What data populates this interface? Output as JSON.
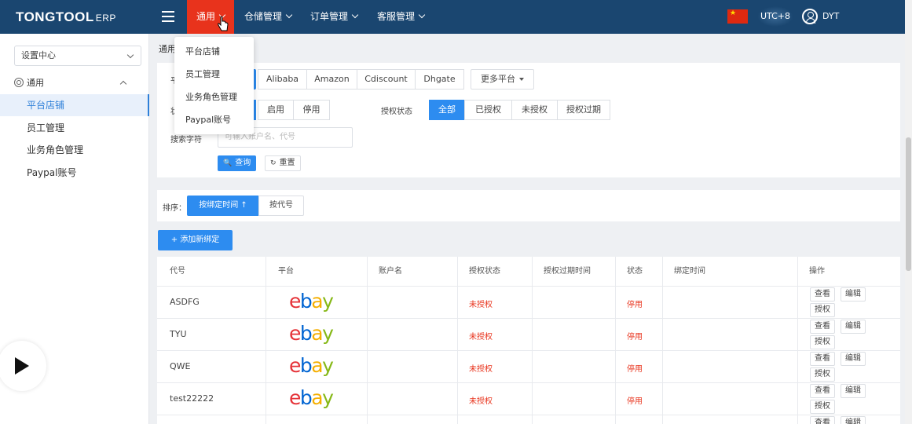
{
  "header": {
    "brand": "TONGTOOL",
    "brand_suffix": "ERP",
    "nav": [
      "通用",
      "仓储管理",
      "订单管理",
      "客服管理"
    ],
    "timezone": "UTC+8",
    "user": "DYT",
    "colors": {
      "bar": "#1a4670",
      "active": "#e8331c"
    }
  },
  "sidebar": {
    "select_value": "设置中心",
    "group_label": "通用",
    "items": [
      "平台店铺",
      "员工管理",
      "业务角色管理",
      "Paypal账号"
    ]
  },
  "breadcrumb": "通用",
  "dropdown": {
    "items": [
      "平台店铺",
      "员工管理",
      "业务角色管理",
      "Paypal账号"
    ]
  },
  "filters": {
    "platform_label": "平",
    "platforms": [
      "Alibaba",
      "Amazon",
      "Cdiscount",
      "Dhgate"
    ],
    "more_platforms": "更多平台",
    "status_label": "状",
    "status_options": [
      "启用",
      "停用"
    ],
    "auth_label": "授权状态",
    "auth_options": [
      "全部",
      "已授权",
      "未授权",
      "授权过期"
    ],
    "search_label": "搜索字符",
    "search_placeholder": "可输入账户名、代号",
    "query_button": "查询",
    "reset_button": "重置"
  },
  "sort": {
    "label": "排序：",
    "options": [
      "按绑定时间",
      "按代号"
    ]
  },
  "add_button": "添加新绑定",
  "table": {
    "headers": [
      "代号",
      "平台",
      "账户名",
      "授权状态",
      "授权过期时间",
      "状态",
      "绑定时间",
      "操作"
    ],
    "rows": [
      {
        "code": "ASDFG",
        "platform": "ebay",
        "account": "",
        "auth": "未授权",
        "expire": "",
        "status": "停用",
        "bind_time": ""
      },
      {
        "code": "TYU",
        "platform": "ebay",
        "account": "",
        "auth": "未授权",
        "expire": "",
        "status": "停用",
        "bind_time": ""
      },
      {
        "code": "QWE",
        "platform": "ebay",
        "account": "",
        "auth": "未授权",
        "expire": "",
        "status": "停用",
        "bind_time": ""
      },
      {
        "code": "test22222",
        "platform": "ebay",
        "account": "",
        "auth": "未授权",
        "expire": "",
        "status": "停用",
        "bind_time": ""
      }
    ],
    "row_actions": [
      "查看",
      "编辑",
      "授权"
    ]
  }
}
